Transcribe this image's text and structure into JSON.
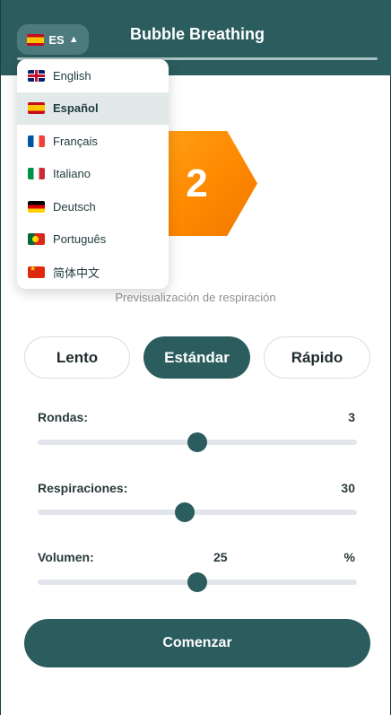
{
  "header": {
    "title": "Bubble Breathing",
    "language_button": {
      "code": "ES",
      "flag": "es",
      "caret": "▲"
    }
  },
  "language_menu": {
    "items": [
      {
        "label": "English",
        "flag": "gb",
        "selected": false
      },
      {
        "label": "Español",
        "flag": "es",
        "selected": true
      },
      {
        "label": "Français",
        "flag": "fr",
        "selected": false
      },
      {
        "label": "Italiano",
        "flag": "it",
        "selected": false
      },
      {
        "label": "Deutsch",
        "flag": "de",
        "selected": false
      },
      {
        "label": "Português",
        "flag": "pt",
        "selected": false
      },
      {
        "label": "简体中文",
        "flag": "cn",
        "selected": false
      }
    ]
  },
  "preview": {
    "count": "2",
    "label": "Previsualización de respiración"
  },
  "speed": {
    "slow": "Lento",
    "standard": "Estándar",
    "fast": "Rápido",
    "active": "standard"
  },
  "sliders": {
    "rounds": {
      "label": "Rondas:",
      "value": "3",
      "fraction": 0.5
    },
    "breaths": {
      "label": "Respiraciones:",
      "value": "30",
      "fraction": 0.46
    },
    "volume": {
      "label": "Volumen:",
      "value": "25",
      "unit": "%",
      "fraction": 0.5
    }
  },
  "start_button": "Comenzar",
  "colors": {
    "primary": "#2b5c5e",
    "accent": "#ff8a00",
    "track": "#e2e6ec"
  }
}
